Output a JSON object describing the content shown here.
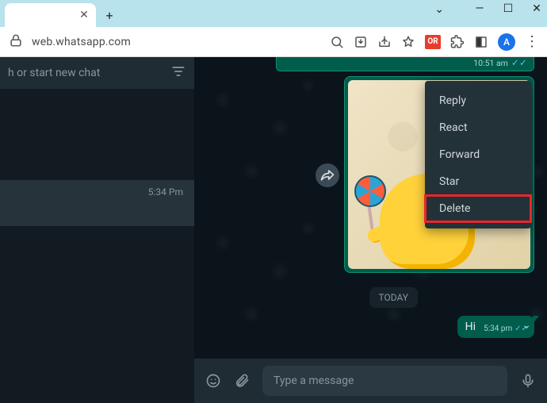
{
  "browser": {
    "url": "web.whatsapp.com",
    "ext_badge": "OR",
    "avatar_initial": "A"
  },
  "sidebar": {
    "search_placeholder": "h or start new chat",
    "selected_chat_time": "5:34 Pm"
  },
  "chat": {
    "prev_time": "10:51 am",
    "today_label": "TODAY",
    "hi_text": "Hi",
    "hi_time": "5:34 pm",
    "composer_placeholder": "Type a message"
  },
  "context_menu": {
    "items": [
      "Reply",
      "React",
      "Forward",
      "Star",
      "Delete"
    ],
    "highlight_index": 4
  }
}
